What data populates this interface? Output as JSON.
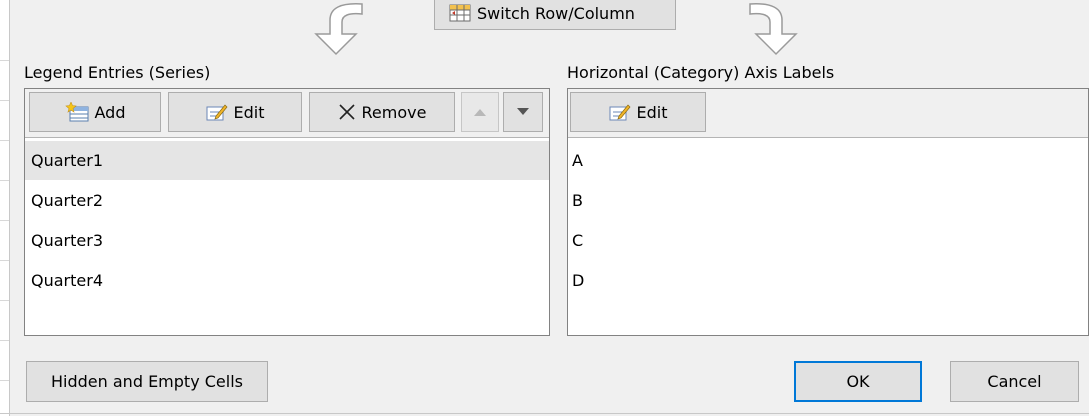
{
  "switch_button": {
    "label": "Switch Row/Column",
    "icon": "switch-row-column-icon"
  },
  "legend": {
    "heading": "Legend Entries (Series)",
    "buttons": {
      "add": "Add",
      "edit": "Edit",
      "remove": "Remove"
    },
    "move_up_icon": "triangle-up-icon",
    "move_down_icon": "triangle-down-icon",
    "series": [
      "Quarter1",
      "Quarter2",
      "Quarter3",
      "Quarter4"
    ],
    "selected_index": 0
  },
  "axis": {
    "heading": "Horizontal (Category) Axis Labels",
    "edit_label": "Edit",
    "labels": [
      "A",
      "B",
      "C",
      "D"
    ]
  },
  "footer": {
    "hidden_cells_label": "Hidden and Empty Cells",
    "ok_label": "OK",
    "cancel_label": "Cancel"
  },
  "colors": {
    "dialog_background": "#f0f0f0",
    "default_button_border": "#0078d7",
    "selected_row": "#e5e5e5"
  }
}
